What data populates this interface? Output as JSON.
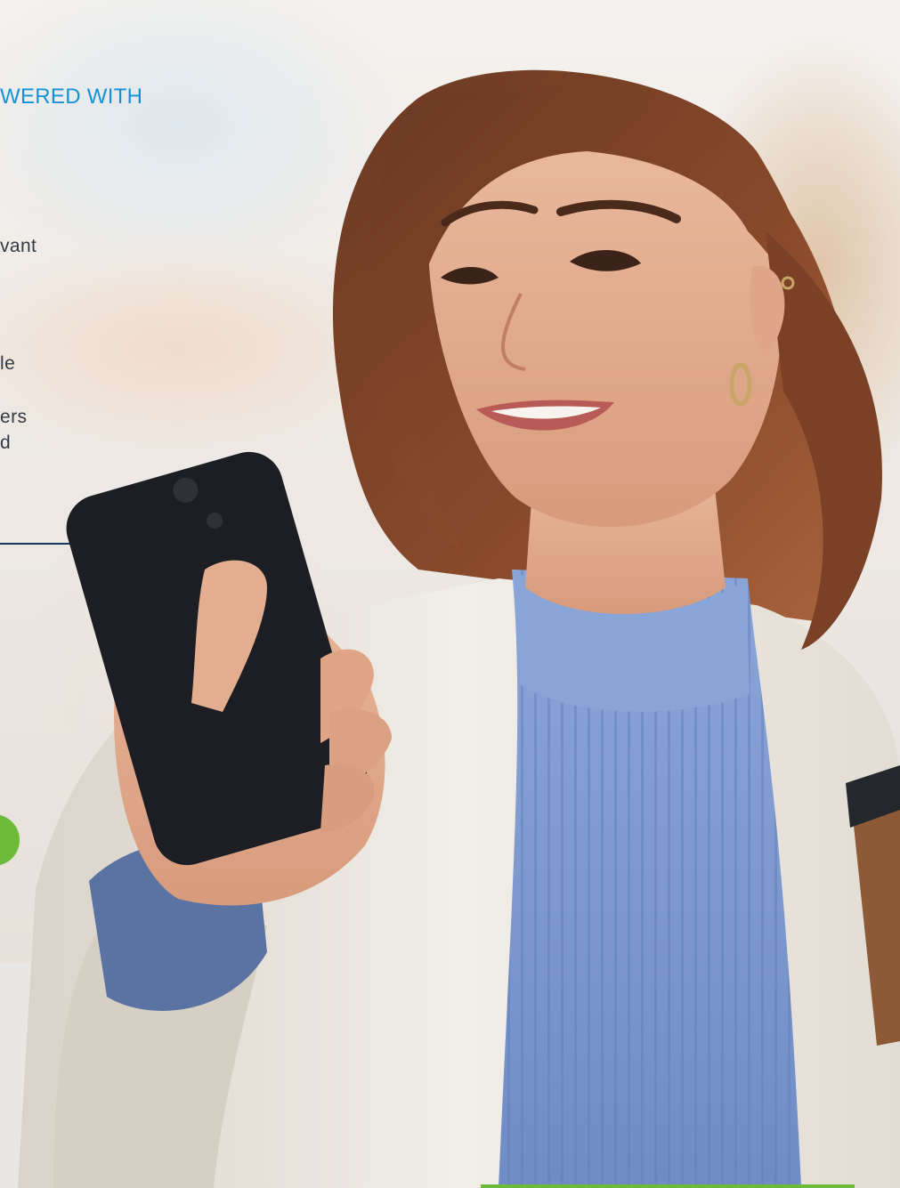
{
  "hero": {
    "heading_fragment": "WERED WITH",
    "body_fragments": [
      "vant",
      "le",
      "ers",
      "d"
    ]
  },
  "cta": {
    "label": ""
  },
  "photo": {
    "icon": "woman-with-smartphone-photo",
    "subject": "smiling woman holding a smartphone and a coffee cup"
  },
  "colors": {
    "heading": "#1592d6",
    "body_text": "#333a44",
    "divider": "#16375e",
    "accent_green": "#6dbb38",
    "sweater": "#7e9bd0",
    "coat": "#ede9e1"
  }
}
